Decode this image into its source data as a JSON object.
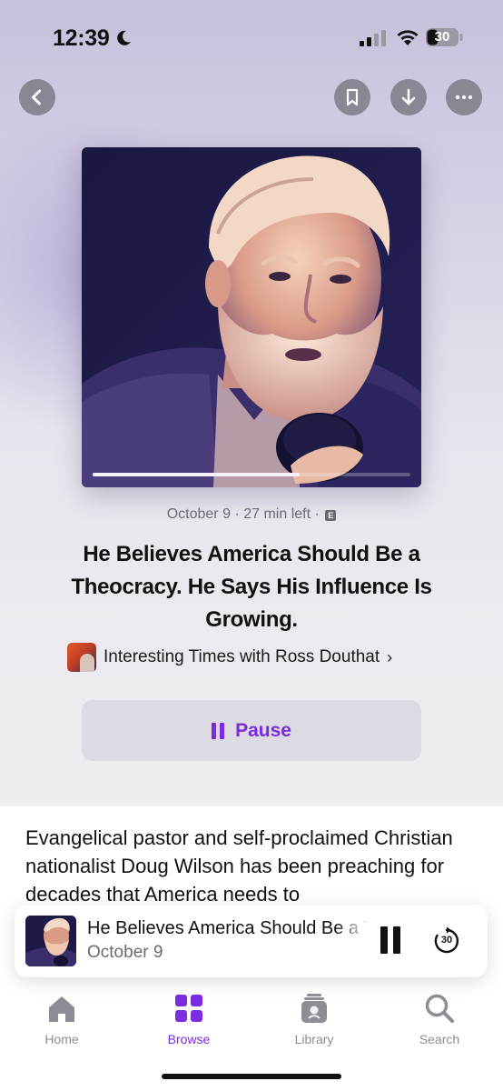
{
  "status_bar": {
    "time": "12:39",
    "battery_level": "30",
    "icons": [
      "moon-icon",
      "signal-icon",
      "wifi-icon",
      "battery-icon"
    ]
  },
  "nav": {
    "icons": [
      "chevron-left-icon",
      "bookmark-icon",
      "download-icon",
      "more-icon"
    ]
  },
  "episode": {
    "date": "October 9",
    "time_left": "27 min left",
    "explicit_badge": "E",
    "title": "He Believes America Should Be a Theocracy. He Says His Influence Is Growing.",
    "show_name": "Interesting Times with Ross Douthat",
    "progress_fraction": 0.65
  },
  "pause_button": {
    "label": "Pause"
  },
  "description": "Evangelical pastor and self-proclaimed Christian nationalist Doug Wilson has been preaching for decades that America needs to",
  "mini_player": {
    "title": "He Believes America Should Be a Theocracy. He Says His Influence Is Growing.",
    "subtitle": "October 9",
    "skip_label": "30"
  },
  "tabs": [
    {
      "label": "Home",
      "icon": "home-icon",
      "active": false
    },
    {
      "label": "Browse",
      "icon": "grid-icon",
      "active": true
    },
    {
      "label": "Library",
      "icon": "library-icon",
      "active": false
    },
    {
      "label": "Search",
      "icon": "search-icon",
      "active": false
    }
  ],
  "colors": {
    "accent": "#7b2be0",
    "artwork_shadow": "#1d1a45",
    "artwork_highlight": "#f0c7ae"
  }
}
